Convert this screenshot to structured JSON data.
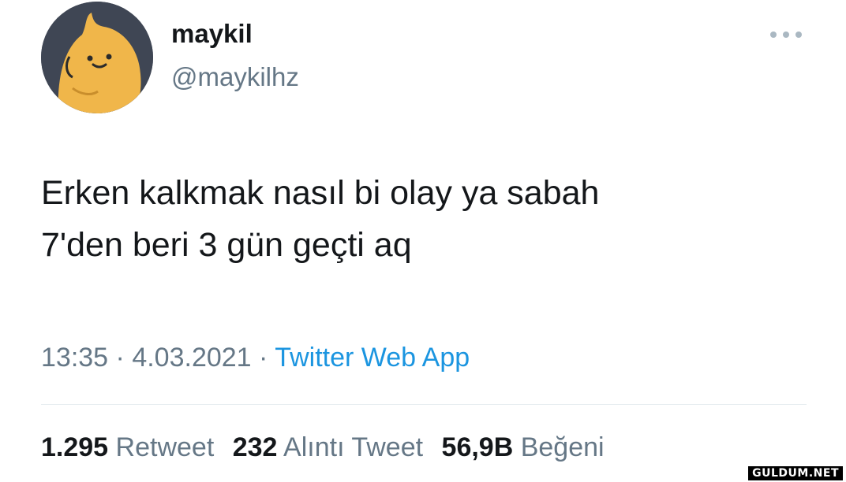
{
  "user": {
    "display_name": "maykil",
    "handle": "@maykilhz",
    "avatar_icon": "cartoon-character-avatar"
  },
  "menu": {
    "icon": "more-options-icon"
  },
  "tweet": {
    "text_lines": [
      "Erken kalkmak nasıl bi olay ya sabah",
      "7'den beri 3 gün geçti aq"
    ]
  },
  "meta": {
    "time": "13:35",
    "separator": "·",
    "date": "4.03.2021",
    "source": "Twitter Web App"
  },
  "stats": {
    "retweets": {
      "count": "1.295",
      "label": "Retweet"
    },
    "quotes": {
      "count": "232",
      "label": "Alıntı Tweet"
    },
    "likes": {
      "count": "56,9B",
      "label": "Beğeni"
    }
  },
  "watermark": "GULDUM.NET",
  "colors": {
    "text": "#14171a",
    "secondary": "#657786",
    "link": "#1b95e0",
    "divider": "#e6ecf0",
    "avatar_bg": "#3f4654",
    "avatar_character": "#f0b64a"
  }
}
